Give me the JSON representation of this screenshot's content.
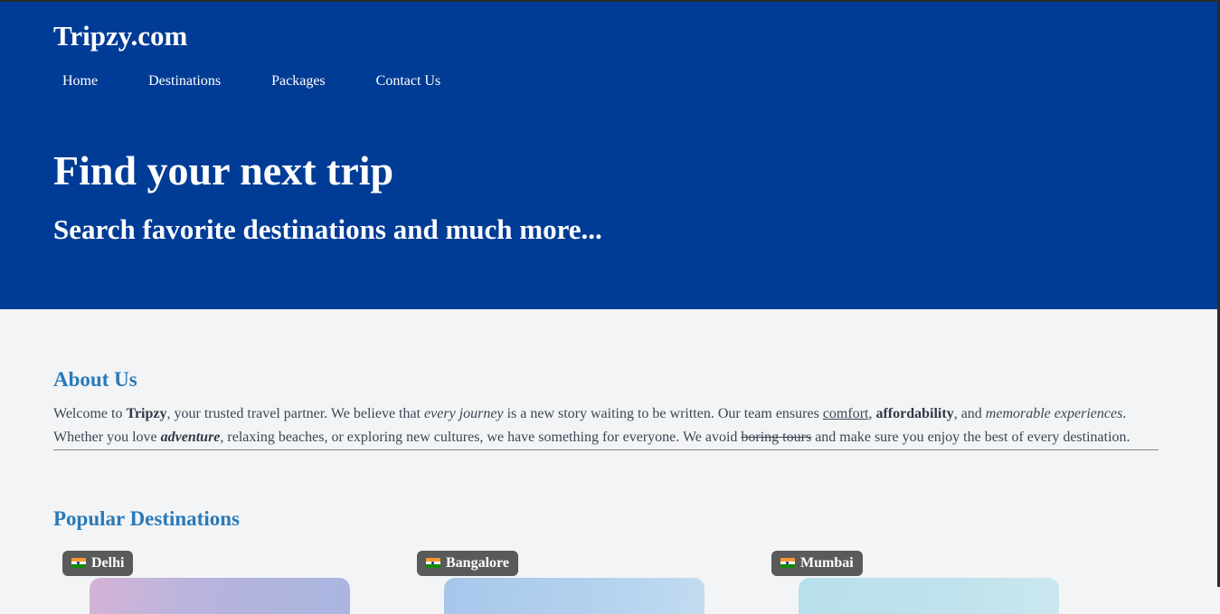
{
  "header": {
    "brand": "Tripzy.com",
    "nav": [
      "Home",
      "Destinations",
      "Packages",
      "Contact Us"
    ],
    "hero_title": "Find your next trip",
    "hero_subtitle": "Search favorite destinations and much more..."
  },
  "about": {
    "title": "About Us",
    "t1": "Welcome to ",
    "brand": "Tripzy",
    "t2": ", your trusted travel partner. We believe that ",
    "em1": "every journey",
    "t3": " is a new story waiting to be written. Our team ensures ",
    "u1": "comfort",
    "t4": ", ",
    "b1": "affordability",
    "t5": ", and ",
    "em2": "memorable experiences",
    "t6": ". Whether you love ",
    "be1": "adventure",
    "t7": ", relaxing beaches, or exploring new cultures, we have something for everyone. We avoid ",
    "s1": "boring tours",
    "t8": " and make sure you enjoy the best of every destination."
  },
  "destinations": {
    "title": "Popular Destinations",
    "cards": [
      {
        "name": "Delhi",
        "flag_icon": "india-flag-icon",
        "tint": "#b9b4dd"
      },
      {
        "name": "Bangalore",
        "flag_icon": "india-flag-icon",
        "tint": "#b4d2ee"
      },
      {
        "name": "Mumbai",
        "flag_icon": "india-flag-icon",
        "tint": "#c0e2ec"
      }
    ]
  },
  "colors": {
    "header_bg": "#003c96",
    "accent": "#2a7ab8",
    "page_bg": "#f3f4f6",
    "badge_bg": "#5a5a5a"
  }
}
